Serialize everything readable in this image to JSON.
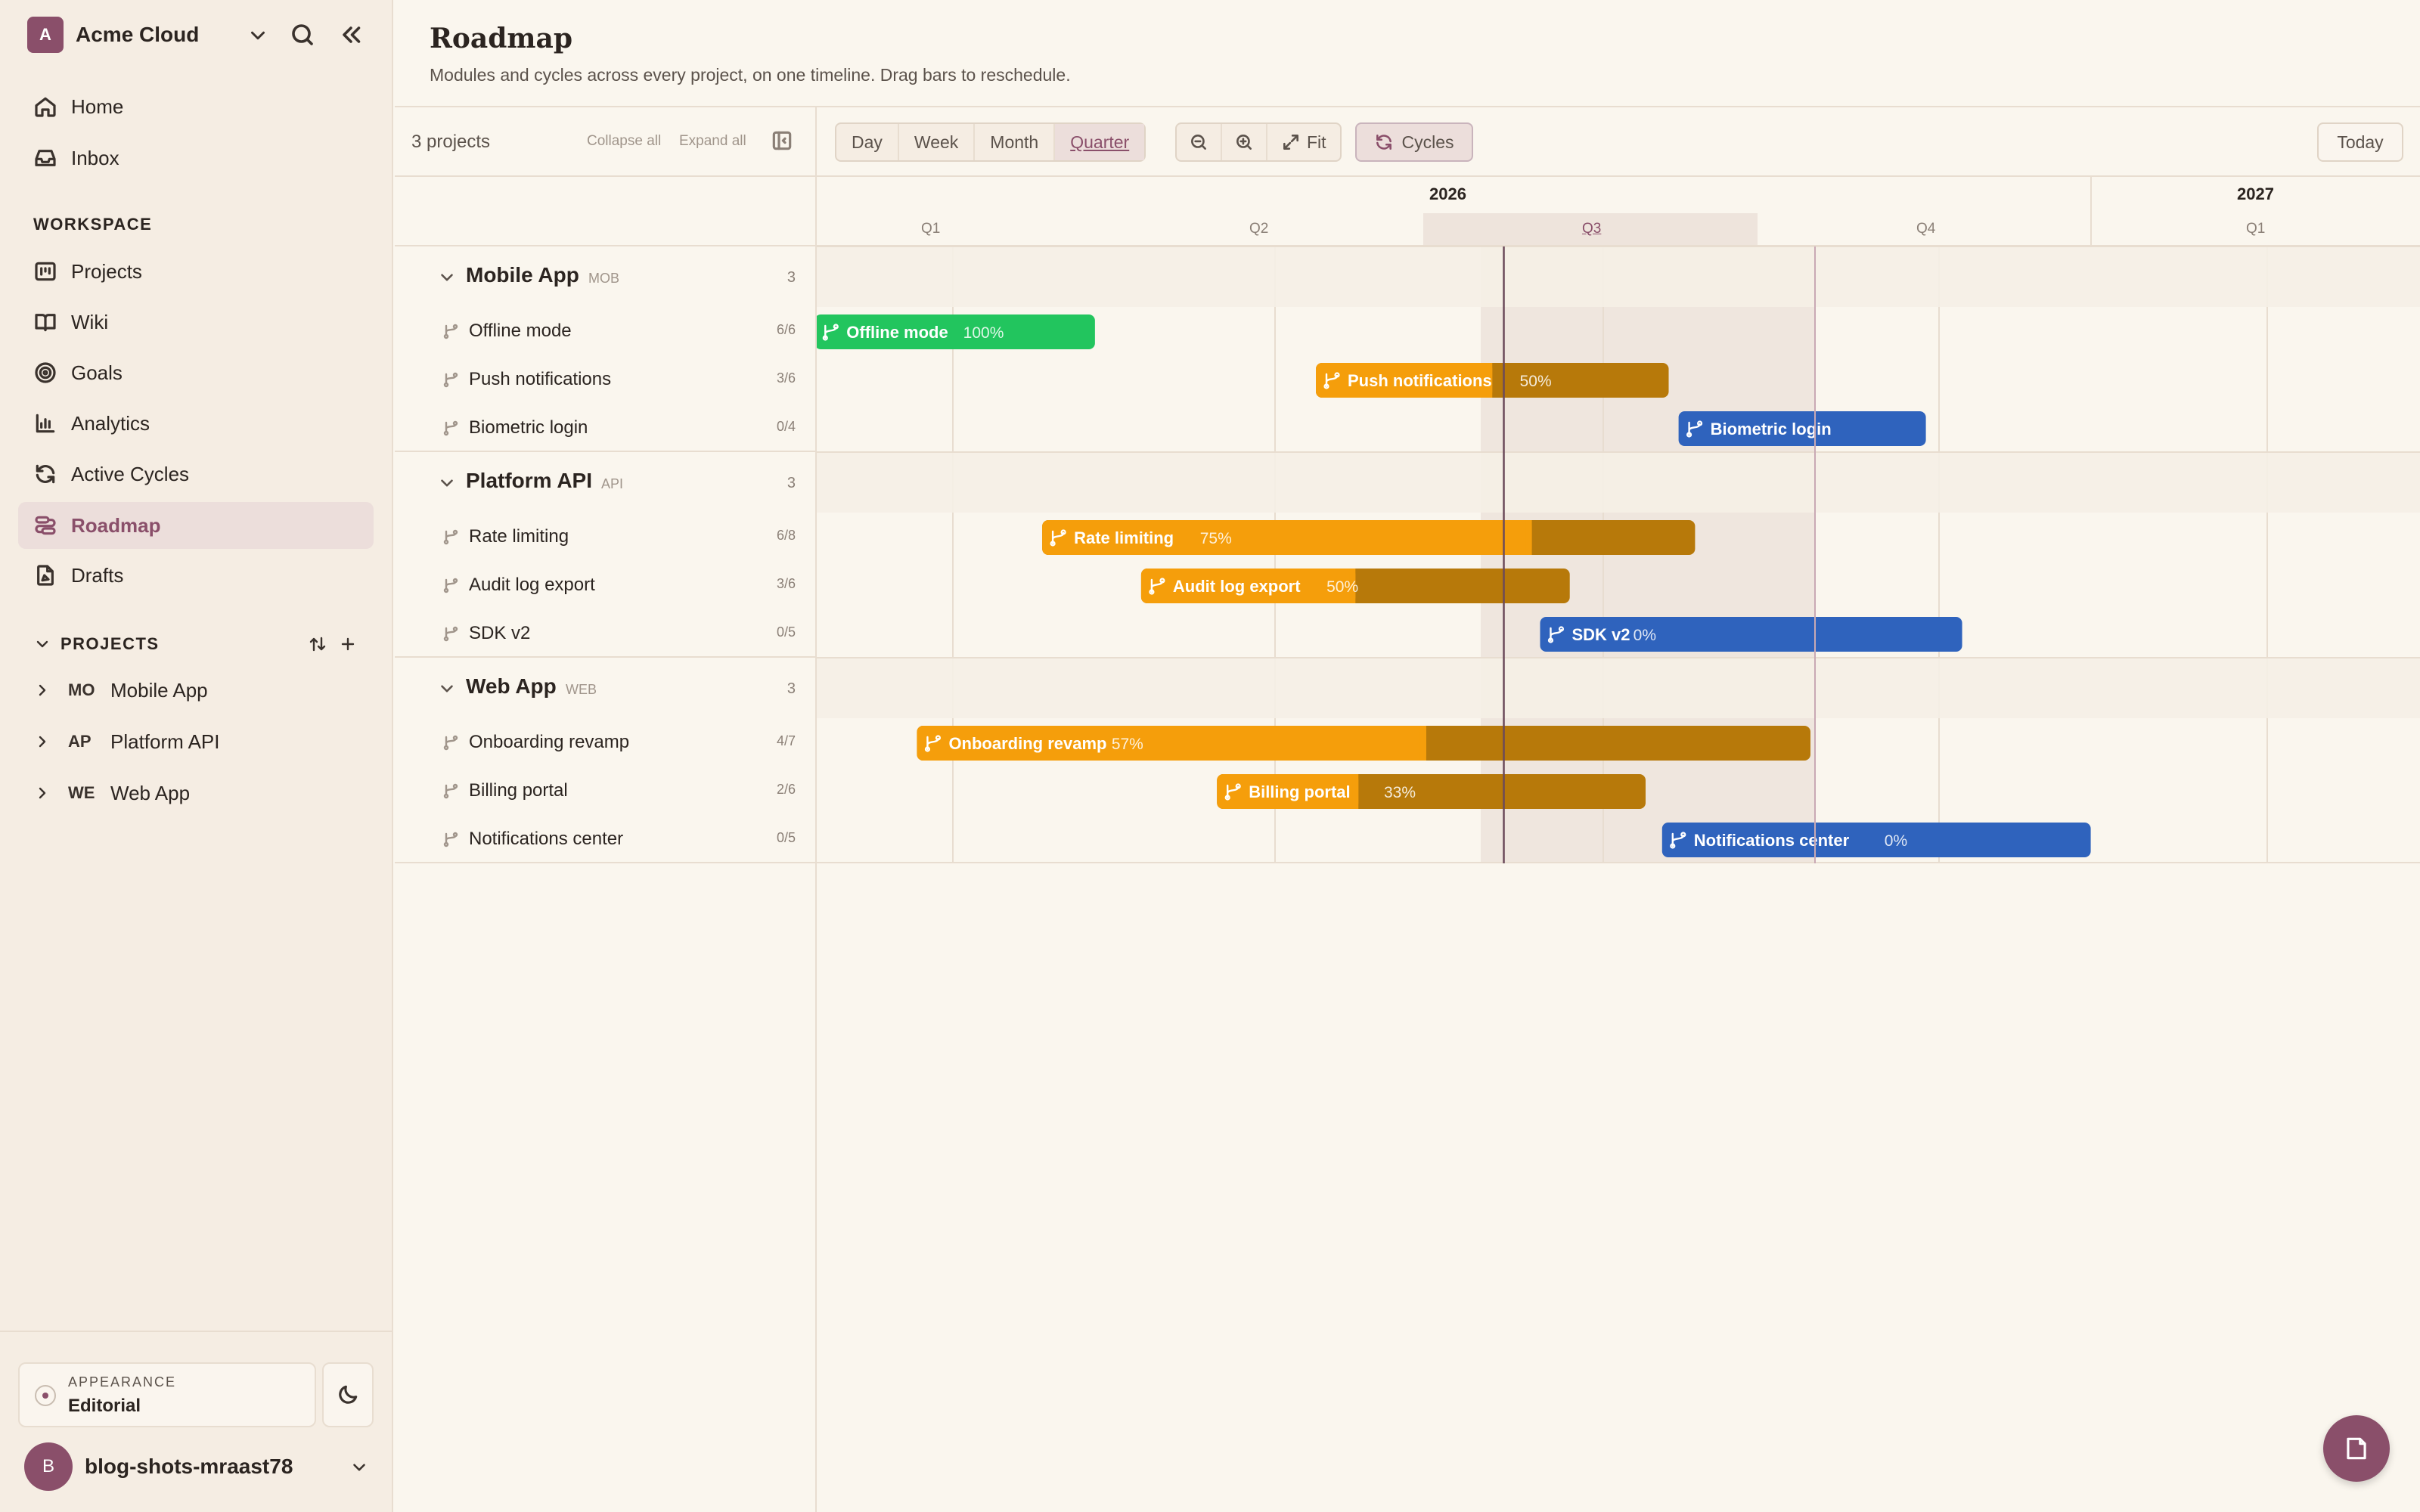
{
  "workspace": {
    "avatar": "A",
    "name": "Acme Cloud"
  },
  "nav": [
    {
      "label": "Home",
      "icon": "home-icon"
    },
    {
      "label": "Inbox",
      "icon": "inbox-icon"
    }
  ],
  "workspace_section": {
    "label": "WORKSPACE",
    "items": [
      {
        "label": "Projects",
        "icon": "projects-icon"
      },
      {
        "label": "Wiki",
        "icon": "book-icon"
      },
      {
        "label": "Goals",
        "icon": "target-icon"
      },
      {
        "label": "Analytics",
        "icon": "chart-icon"
      },
      {
        "label": "Active Cycles",
        "icon": "refresh-icon"
      },
      {
        "label": "Roadmap",
        "icon": "roadmap-icon",
        "active": true
      },
      {
        "label": "Drafts",
        "icon": "drafts-icon"
      }
    ]
  },
  "projects_section": {
    "label": "PROJECTS",
    "items": [
      {
        "code": "MO",
        "name": "Mobile App"
      },
      {
        "code": "AP",
        "name": "Platform API"
      },
      {
        "code": "WE",
        "name": "Web App"
      }
    ]
  },
  "appearance": {
    "label": "APPEARANCE",
    "value": "Editorial"
  },
  "user": {
    "avatar": "B",
    "name": "blog-shots-mraast78"
  },
  "page": {
    "title": "Roadmap",
    "subtitle": "Modules and cycles across every project, on one timeline. Drag bars to reschedule."
  },
  "toolbar": {
    "count": "3 projects",
    "collapse_all": "Collapse all",
    "expand_all": "Expand all",
    "zoom_options": [
      "Day",
      "Week",
      "Month",
      "Quarter"
    ],
    "zoom_selected": "Quarter",
    "fit": "Fit",
    "cycles": "Cycles",
    "today": "Today"
  },
  "timeline": {
    "years": [
      {
        "label": "2026"
      },
      {
        "label": "2027"
      }
    ],
    "quarters": [
      "Q1",
      "Q2",
      "Q3",
      "Q4",
      "Q1"
    ],
    "current_quarter": 2,
    "today_fraction": 0.07
  },
  "groups": [
    {
      "name": "Mobile App",
      "code": "MOB",
      "count": "3",
      "modules": [
        {
          "name": "Offline mode",
          "progress": "6/6",
          "bar_label": "Offline mode",
          "percent": 100,
          "status": "done",
          "start_q": -0.02,
          "end_q": 0.83
        },
        {
          "name": "Push notifications",
          "progress": "3/6",
          "bar_label": "Push notifications",
          "percent": 50,
          "status": "in-progress",
          "start_q": 1.5,
          "end_q": 2.57
        },
        {
          "name": "Biometric login",
          "progress": "0/4",
          "bar_label": "Biometric login",
          "percent": null,
          "status": "planned",
          "start_q": 2.6,
          "end_q": 3.35
        }
      ]
    },
    {
      "name": "Platform API",
      "code": "API",
      "count": "3",
      "modules": [
        {
          "name": "Rate limiting",
          "progress": "6/8",
          "bar_label": "Rate limiting",
          "percent": 75,
          "status": "in-progress",
          "start_q": 0.67,
          "end_q": 2.65
        },
        {
          "name": "Audit log export",
          "progress": "3/6",
          "bar_label": "Audit log export",
          "percent": 50,
          "status": "in-progress",
          "start_q": 0.97,
          "end_q": 2.27
        },
        {
          "name": "SDK v2",
          "progress": "0/5",
          "bar_label": "SDK v2",
          "percent": 0,
          "status": "planned",
          "start_q": 2.18,
          "end_q": 3.46
        }
      ]
    },
    {
      "name": "Web App",
      "code": "WEB",
      "count": "3",
      "modules": [
        {
          "name": "Onboarding revamp",
          "progress": "4/7",
          "bar_label": "Onboarding revamp",
          "percent": 57,
          "status": "in-progress",
          "start_q": 0.29,
          "end_q": 3.0
        },
        {
          "name": "Billing portal",
          "progress": "2/6",
          "bar_label": "Billing portal",
          "percent": 33,
          "status": "in-progress",
          "start_q": 1.2,
          "end_q": 2.5
        },
        {
          "name": "Notifications center",
          "progress": "0/5",
          "bar_label": "Notifications center",
          "percent": 0,
          "status": "planned",
          "start_q": 2.55,
          "end_q": 3.85
        }
      ]
    }
  ],
  "colors": {
    "accent": "#8a4f6a",
    "done": "#22c55e",
    "in_progress": "#f59e0b",
    "in_progress_dark": "#b7790a",
    "planned": "#2f63bd"
  }
}
